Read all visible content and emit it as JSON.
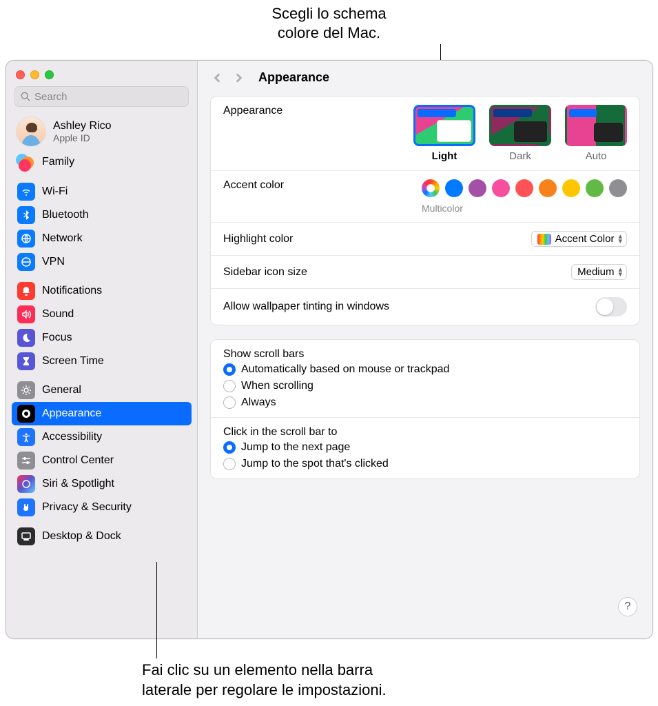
{
  "callouts": {
    "top": "Scegli lo schema\ncolore del Mac.",
    "bottom": "Fai clic su un elemento nella barra\nlaterale per regolare le impostazioni."
  },
  "search": {
    "placeholder": "Search"
  },
  "account": {
    "name": "Ashley Rico",
    "sub": "Apple ID"
  },
  "family": {
    "label": "Family"
  },
  "sidebar": {
    "group1": [
      {
        "id": "wifi",
        "label": "Wi-Fi"
      },
      {
        "id": "bluetooth",
        "label": "Bluetooth"
      },
      {
        "id": "network",
        "label": "Network"
      },
      {
        "id": "vpn",
        "label": "VPN"
      }
    ],
    "group2": [
      {
        "id": "notifications",
        "label": "Notifications"
      },
      {
        "id": "sound",
        "label": "Sound"
      },
      {
        "id": "focus",
        "label": "Focus"
      },
      {
        "id": "screentime",
        "label": "Screen Time"
      }
    ],
    "group3": [
      {
        "id": "general",
        "label": "General"
      },
      {
        "id": "appearance",
        "label": "Appearance"
      },
      {
        "id": "accessibility",
        "label": "Accessibility"
      },
      {
        "id": "controlcenter",
        "label": "Control Center"
      },
      {
        "id": "siri",
        "label": "Siri & Spotlight"
      },
      {
        "id": "privacy",
        "label": "Privacy & Security"
      }
    ],
    "group4": [
      {
        "id": "desktop",
        "label": "Desktop & Dock"
      }
    ]
  },
  "page": {
    "title": "Appearance"
  },
  "appearance": {
    "label": "Appearance",
    "options": {
      "light": "Light",
      "dark": "Dark",
      "auto": "Auto"
    },
    "selected": "light"
  },
  "accent": {
    "label": "Accent color",
    "selected_name": "Multicolor",
    "colors": [
      "#007aff",
      "#a550a7",
      "#f74f9e",
      "#ff5257",
      "#f7821b",
      "#ffc600",
      "#62ba46",
      "#8e8e93"
    ]
  },
  "highlight": {
    "label": "Highlight color",
    "value": "Accent Color"
  },
  "sidebar_size": {
    "label": "Sidebar icon size",
    "value": "Medium"
  },
  "tinting": {
    "label": "Allow wallpaper tinting in windows",
    "on": false
  },
  "scroll": {
    "heading": "Show scroll bars",
    "options": [
      "Automatically based on mouse or trackpad",
      "When scrolling",
      "Always"
    ],
    "selected": 0
  },
  "click": {
    "heading": "Click in the scroll bar to",
    "options": [
      "Jump to the next page",
      "Jump to the spot that's clicked"
    ],
    "selected": 0
  },
  "help": "?"
}
